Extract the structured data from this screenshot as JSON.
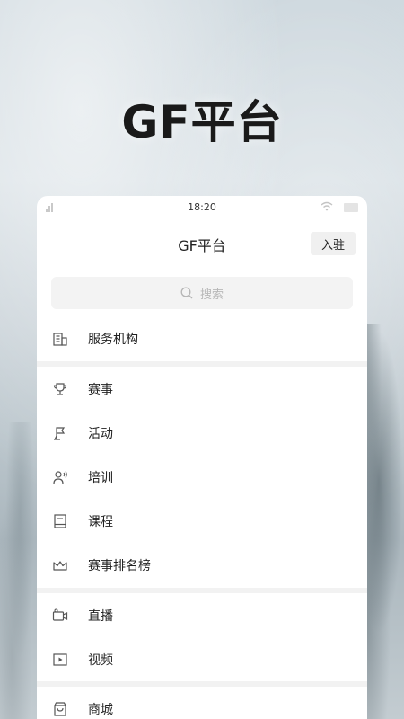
{
  "hero": {
    "title": "GF平台"
  },
  "status_bar": {
    "time": "18:20"
  },
  "header": {
    "title": "GF平台",
    "join_label": "入驻"
  },
  "search": {
    "placeholder": "搜索"
  },
  "menu": {
    "group1": [
      {
        "label": "服务机构",
        "icon": "building-icon"
      }
    ],
    "group2": [
      {
        "label": "赛事",
        "icon": "trophy-icon"
      },
      {
        "label": "活动",
        "icon": "flag-icon"
      },
      {
        "label": "培训",
        "icon": "person-speaking-icon"
      },
      {
        "label": "课程",
        "icon": "book-icon"
      },
      {
        "label": "赛事排名榜",
        "icon": "crown-icon"
      }
    ],
    "group3": [
      {
        "label": "直播",
        "icon": "video-camera-icon"
      },
      {
        "label": "视频",
        "icon": "play-icon"
      }
    ],
    "group4": [
      {
        "label": "商城",
        "icon": "shopping-bag-icon"
      }
    ]
  }
}
